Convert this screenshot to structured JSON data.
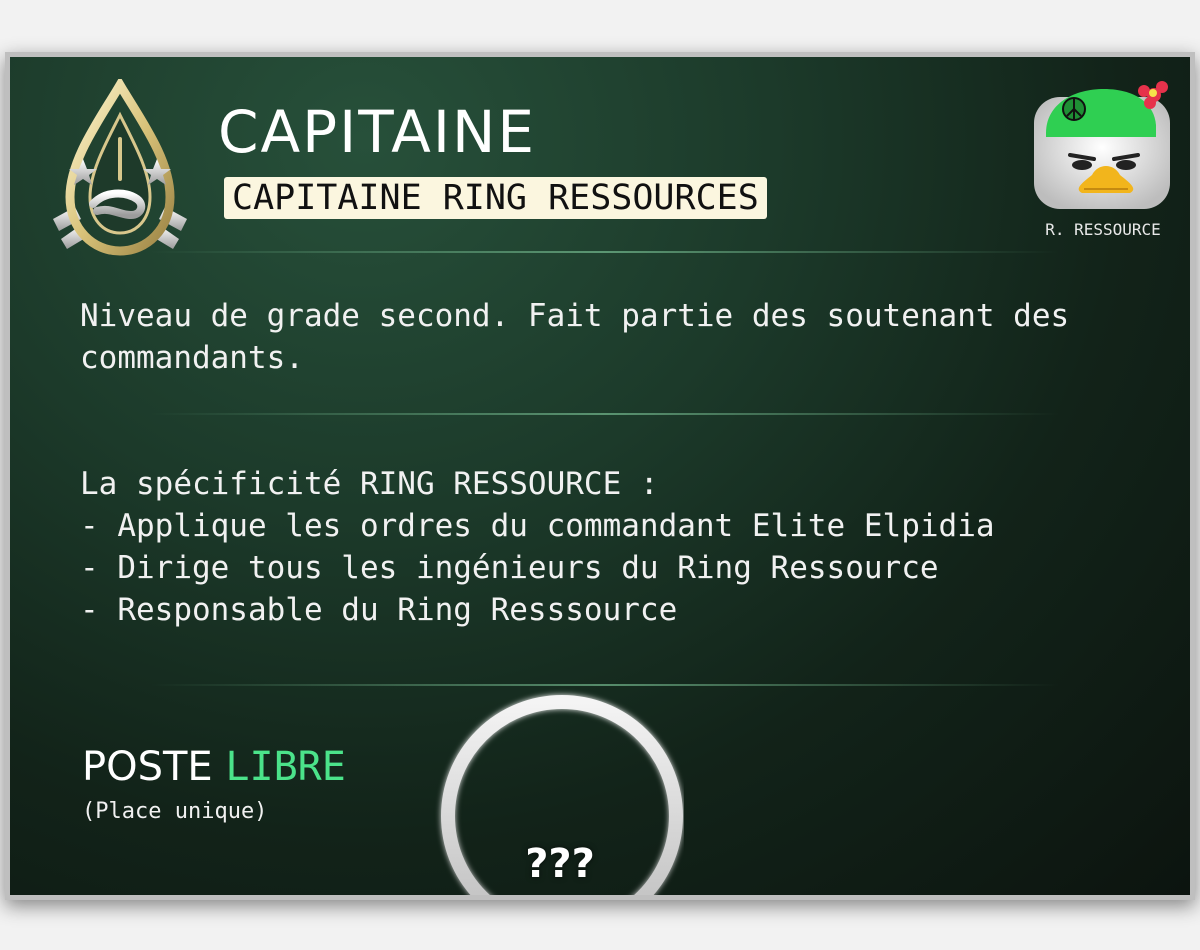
{
  "header": {
    "title": "CAPITAINE",
    "subtitle": "CAPITAINE RING RESSOURCES",
    "emblem_icon": "rank-insignia-icon"
  },
  "avatar": {
    "icon": "duck-avatar-icon",
    "label": "R. RESSOURCE"
  },
  "description": "Niveau de grade second. Fait partie des soutenant des commandants.",
  "specificity": {
    "heading": "La spécificité RING RESSOURCE :",
    "items": [
      "- Applique les ordres du commandant Elite Elpidia",
      "- Dirige tous les ingénieurs du Ring Ressource",
      "- Responsable du Ring Resssource"
    ]
  },
  "post": {
    "label": "POSTE",
    "status": "LIBRE",
    "note": "(Place unique)",
    "placeholder": "???"
  },
  "colors": {
    "status_green": "#4be38a",
    "subtitle_bg": "#fbf6df",
    "card_bg": "#1c3a2a"
  }
}
